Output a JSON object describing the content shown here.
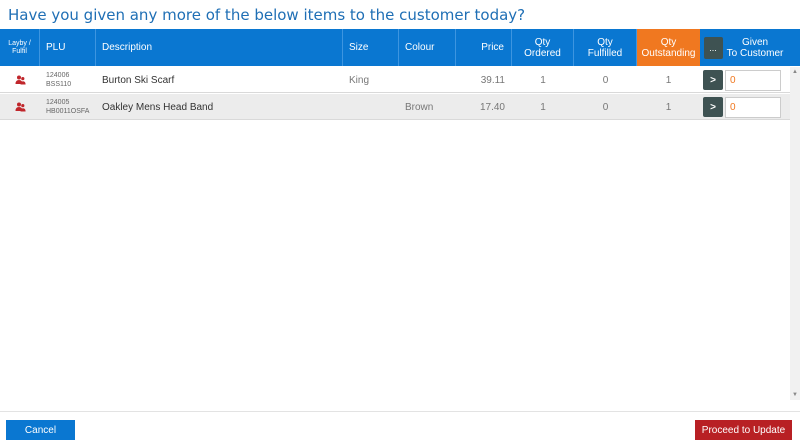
{
  "title": "Have you given any more of the below items to the customer today?",
  "columns": {
    "layby_line1": "Layby /",
    "layby_line2": "Fulfil",
    "plu": "PLU",
    "description": "Description",
    "size": "Size",
    "colour": "Colour",
    "price": "Price",
    "qty_ordered_line1": "Qty",
    "qty_ordered_line2": "Ordered",
    "qty_fulfilled_line1": "Qty",
    "qty_fulfilled_line2": "Fulfilled",
    "qty_outstanding_line1": "Qty",
    "qty_outstanding_line2": "Outstanding",
    "more": "...",
    "given_line1": "Given",
    "given_line2": "To Customer"
  },
  "rows": [
    {
      "icon": "people-icon",
      "plu_line1": "124006",
      "plu_line2": "BSS110",
      "description": "Burton Ski Scarf",
      "size": "King",
      "colour": "",
      "price": "39.11",
      "qty_ordered": "1",
      "qty_fulfilled": "0",
      "qty_outstanding": "1",
      "go_label": ">",
      "given": "0"
    },
    {
      "icon": "people-icon",
      "plu_line1": "124005",
      "plu_line2": "HB0011OSFA",
      "description": "Oakley Mens Head Band",
      "size": "",
      "colour": "Brown",
      "price": "17.40",
      "qty_ordered": "1",
      "qty_fulfilled": "0",
      "qty_outstanding": "1",
      "go_label": ">",
      "given": "0"
    }
  ],
  "buttons": {
    "cancel": "Cancel",
    "proceed": "Proceed to Update"
  },
  "colors": {
    "header": "#0a77d1",
    "outstanding": "#f07820",
    "proceed": "#b82024",
    "dark_button": "#3e5252"
  }
}
